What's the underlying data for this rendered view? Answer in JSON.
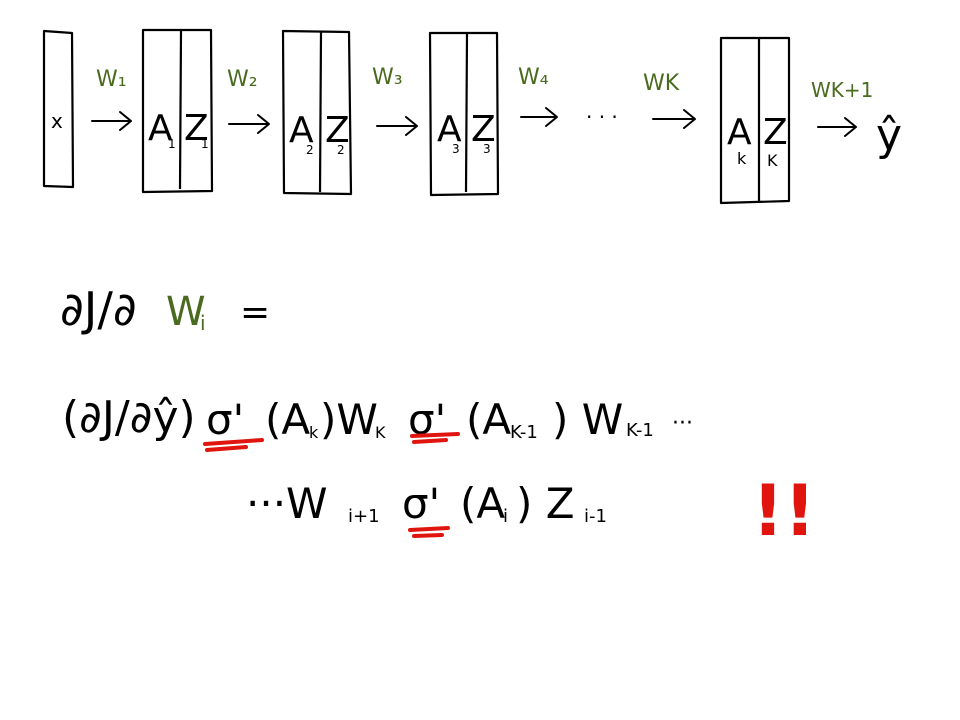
{
  "colors": {
    "ink": "#000000",
    "weight_green": "#4a6b1f",
    "highlight_red": "#e0150f",
    "background": "#ffffff"
  },
  "network": {
    "input": "x",
    "layers": [
      {
        "a": "A",
        "a_sub": "1",
        "z": "Z",
        "z_sub": "1"
      },
      {
        "a": "A",
        "a_sub": "2",
        "z": "Z",
        "z_sub": "2"
      },
      {
        "a": "A",
        "a_sub": "3",
        "z": "Z",
        "z_sub": "3"
      },
      {
        "a": "A",
        "a_sub": "k",
        "z": "Z",
        "z_sub": "K"
      }
    ],
    "weights": [
      "W₁",
      "W₂",
      "W₃",
      "W₄",
      "WK",
      "WK+1"
    ],
    "ellipsis": "· · ·",
    "output": "ŷ"
  },
  "equation": {
    "lhs_prefix": "∂J/∂",
    "lhs_weight": "W",
    "lhs_weight_sub": "i",
    "equals": "=",
    "line1_paren": "(∂J/∂ŷ)",
    "line1_sigma_k": "σ'",
    "line1_term_k": "(A",
    "line1_term_k_sub": "k",
    "line1_w_k": ")W",
    "line1_w_k_sub": "K",
    "line1_sigma_k1": "σ'",
    "line1_term_k1": "(A",
    "line1_term_k1_sub": "K-1",
    "line1_w_k1": ") W",
    "line1_w_k1_sub": "K-1",
    "line1_tail": "···",
    "line2_head": "···W",
    "line2_head_sub": "i+1",
    "line2_sigma": "σ'",
    "line2_term": "(A",
    "line2_term_sub": "i",
    "line2_z": ") Z",
    "line2_z_sub": "i-1",
    "exclaim": "!!"
  }
}
